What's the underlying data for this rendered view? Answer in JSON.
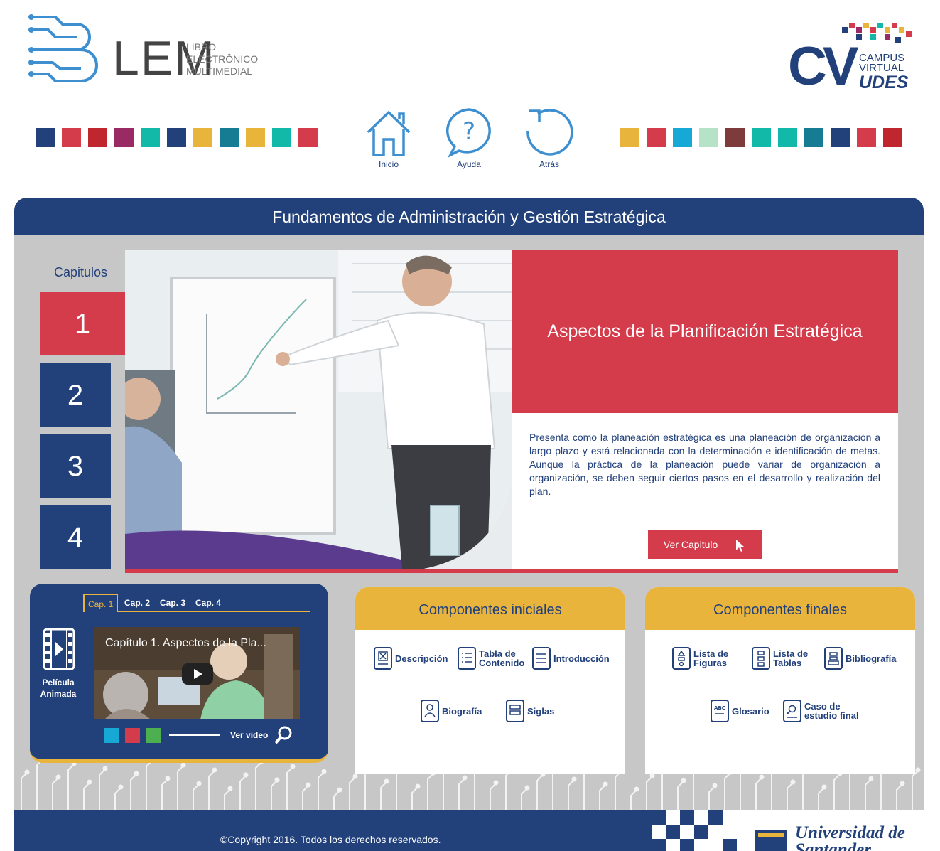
{
  "header": {
    "lem_logo": "LEM",
    "lem_sub_1": "LIBRO",
    "lem_sub_2": "ELECTRÔNICO",
    "lem_sub_3": "MULTIMEDIAL",
    "cv_logo": "CV",
    "cv_sub_1": "CAMPUS",
    "cv_sub_2": "VIRTUAL",
    "cv_sub_3": "UDES"
  },
  "swatches_left": [
    "#22407a",
    "#d43b4b",
    "#c0262d",
    "#9a2a63",
    "#12b8a8",
    "#22407a",
    "#e9b43c",
    "#167c93",
    "#e9b43c",
    "#12b8a8",
    "#d43b4b"
  ],
  "swatches_right": [
    "#e9b43c",
    "#d43b4b",
    "#16a9d6",
    "#b6e2c7",
    "#7e3b3b",
    "#12b8a8",
    "#12b8a8",
    "#167c93",
    "#22407a",
    "#d43b4b",
    "#c0262d"
  ],
  "nav": {
    "home": "Inicio",
    "help": "Ayuda",
    "back": "Atrás"
  },
  "panel_title": "Fundamentos de Administración y Gestión Estratégica",
  "chapters": {
    "label": "Capitulos",
    "items": [
      "1",
      "2",
      "3",
      "4"
    ],
    "active": "1"
  },
  "feature": {
    "title": "Aspectos de la Planificación Estratégica",
    "description": "Presenta como la planeación estratégica es una planeación de organización a largo plazo y está relacionada con la determinación e identificación de metas. Aunque la práctica de la planeación puede variar de organización a organización, se deben seguir ciertos pasos en el desarrollo y realización del plan.",
    "button": "Ver Capitulo"
  },
  "video": {
    "tabs": [
      "Cap. 1",
      "Cap. 2",
      "Cap. 3",
      "Cap. 4"
    ],
    "active_tab": "Cap. 1",
    "label": "Película Animada",
    "title": "Capítulo 1. Aspectos de la Pla...",
    "ver_video": "Ver video",
    "squares": [
      "#16a9d6",
      "#d43b4b",
      "#4caf50"
    ]
  },
  "components_initial": {
    "title": "Componentes iniciales",
    "items": [
      "Descripción",
      "Tabla de Contenido",
      "Introducción",
      "Biografía",
      "Siglas"
    ]
  },
  "components_final": {
    "title": "Componentes finales",
    "items": [
      "Lista de Figuras",
      "Lista de Tablas",
      "Bibliografía",
      "Glosario",
      "Caso de estudio final"
    ]
  },
  "footer": {
    "copyright": "©Copyright 2016. Todos los derechos reservados.",
    "university": "Universidad de Santander"
  },
  "colors": {
    "navy": "#22407a",
    "red": "#d43b4b",
    "gold": "#e9b43c",
    "panel_grey": "#c7c7c7"
  }
}
